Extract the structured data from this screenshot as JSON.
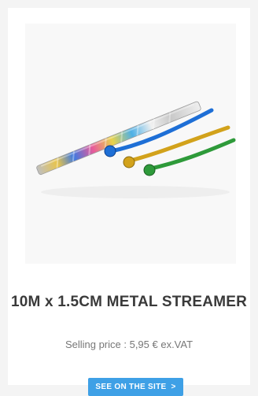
{
  "product": {
    "title": "10M x 1.5CM METAL STREAMER",
    "price_text": "Selling price : 5,95 € ex.VAT",
    "button_label": "SEE ON THE SITE",
    "button_arrow": ">"
  },
  "colors": {
    "button_bg": "#3ea0e6",
    "streamer_blue": "#1e6fd6",
    "streamer_gold": "#d2a21b",
    "streamer_green": "#2e9a3a"
  }
}
